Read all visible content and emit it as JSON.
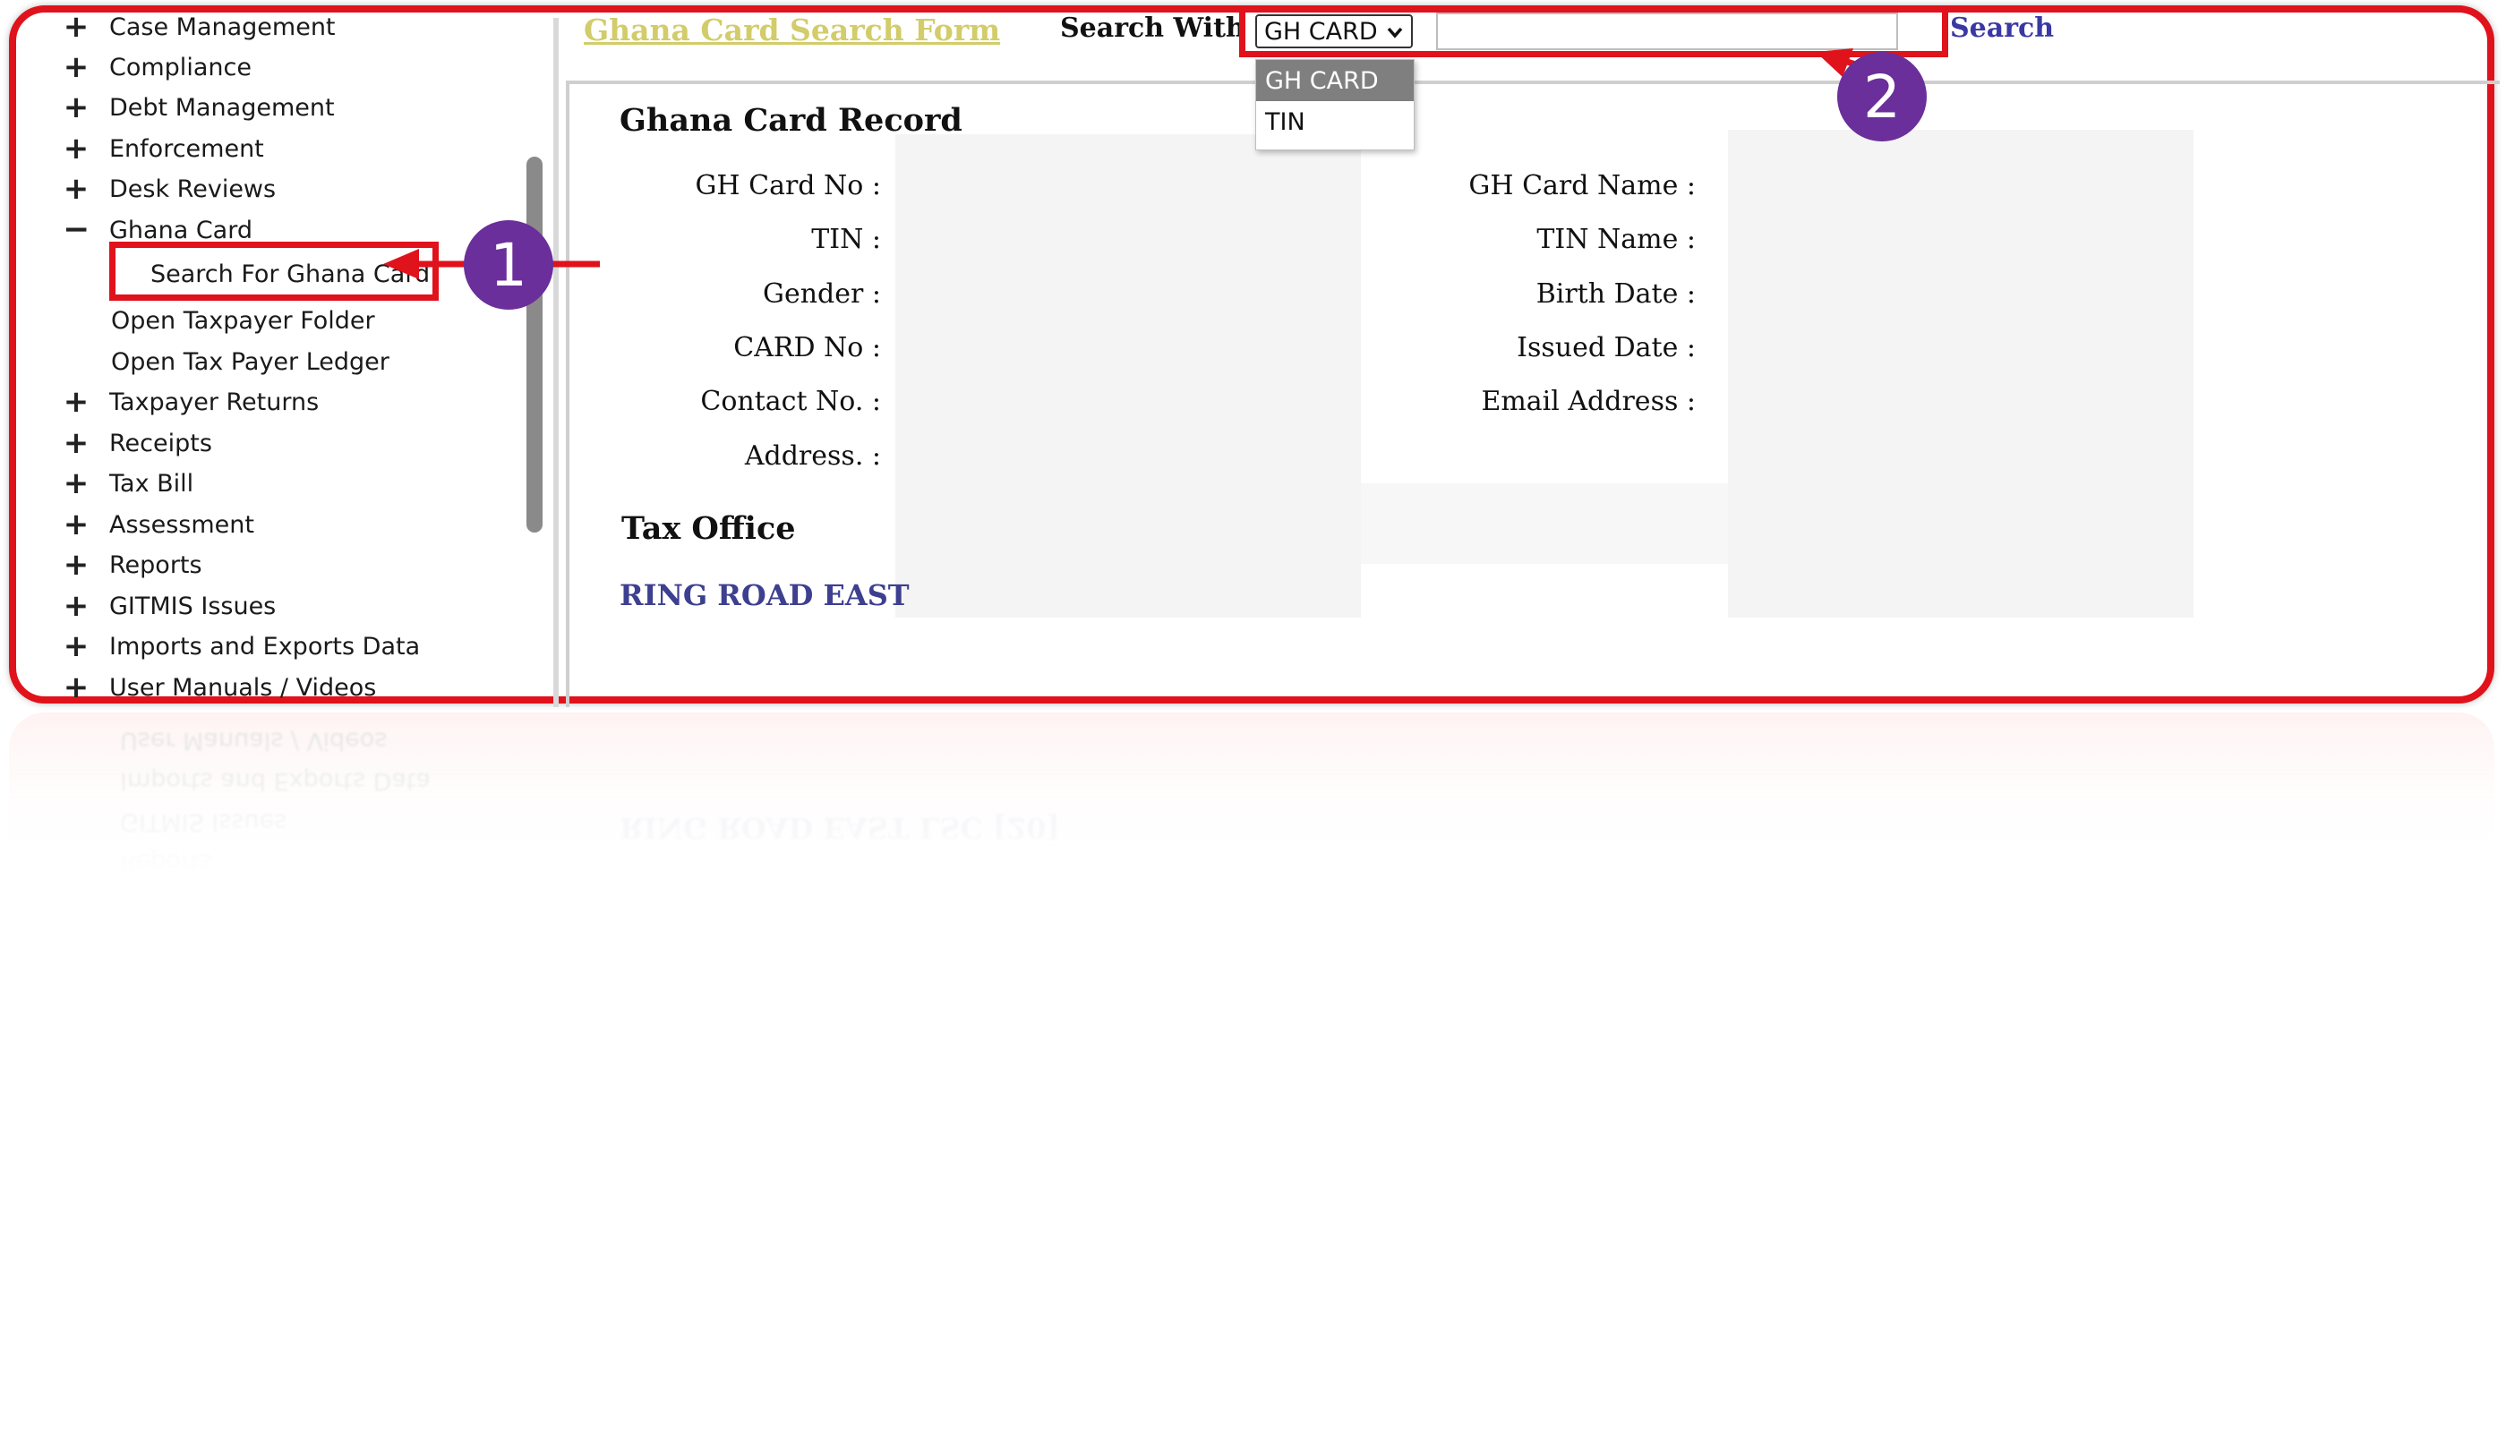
{
  "sidebar": {
    "items_before": [
      {
        "sign": "+",
        "label": "Case Management"
      },
      {
        "sign": "+",
        "label": "Compliance"
      },
      {
        "sign": "+",
        "label": "Debt Management"
      },
      {
        "sign": "+",
        "label": "Enforcement"
      },
      {
        "sign": "+",
        "label": "Desk Reviews"
      }
    ],
    "expanded": {
      "sign": "−",
      "label": "Ghana Card"
    },
    "sub_items": [
      "Search For Ghana Card",
      "Open Taxpayer Folder",
      "Open Tax Payer Ledger"
    ],
    "items_after": [
      {
        "sign": "+",
        "label": "Taxpayer Returns"
      },
      {
        "sign": "+",
        "label": "Receipts"
      },
      {
        "sign": "+",
        "label": "Tax Bill"
      },
      {
        "sign": "+",
        "label": "Assessment"
      },
      {
        "sign": "+",
        "label": "Reports"
      },
      {
        "sign": "+",
        "label": "GITMIS Issues"
      },
      {
        "sign": "+",
        "label": "Imports and Exports Data"
      },
      {
        "sign": "+",
        "label": "User Manuals / Videos"
      }
    ]
  },
  "header": {
    "form_title": "Ghana Card Search Form",
    "search_with_label": "Search With",
    "select_value": "GH CARD",
    "search_input_value": "",
    "search_link": "Search",
    "dropdown_options": [
      "GH CARD",
      "TIN"
    ]
  },
  "record": {
    "title": "Ghana Card Record",
    "left_labels": [
      "GH Card No :",
      "TIN :",
      "Gender :",
      "CARD No :",
      "Contact No. :",
      "Address. :"
    ],
    "right_labels": [
      "GH Card Name :",
      "TIN Name :",
      "Birth Date :",
      "Issued Date :",
      "Email Address :"
    ]
  },
  "tax_office": {
    "title": "Tax Office",
    "value": "RING ROAD EAST"
  },
  "annotations": {
    "badge_1": "1",
    "badge_2": "2"
  },
  "reflection": {
    "items": [
      "User Manuals / Videos",
      "Imports and Exports Data",
      "GITMIS Issues",
      "Reports"
    ],
    "office_text": "RING ROAD EAST LSC    [20]"
  },
  "colors": {
    "annotation_red": "#e0121b",
    "badge_purple": "#6a2f9a",
    "form_title_yellow": "#d2cc6a",
    "link_blue": "#3a38a3"
  }
}
